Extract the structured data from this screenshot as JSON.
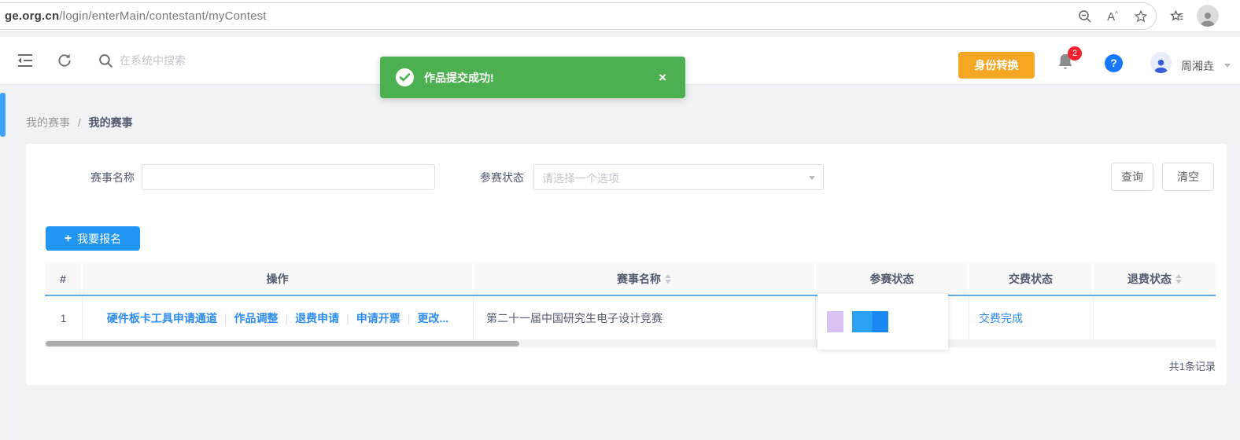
{
  "browser": {
    "url_domain": "ge.org.cn",
    "url_path": "/login/enterMain/contestant/myContest",
    "icons": [
      "zoom-out-icon",
      "read-aloud-icon",
      "favorite-star-icon",
      "collections-icon",
      "profile-avatar"
    ]
  },
  "toolbar": {
    "icons": [
      "menu-fold-icon",
      "refresh-icon",
      "search-icon"
    ],
    "search_placeholder": "在系统中搜索"
  },
  "header": {
    "identity_button": "身份转换",
    "notification_count": "2",
    "help_glyph": "?",
    "username": "周湘垚"
  },
  "toast": {
    "message": "作品提交成功!",
    "close": "×",
    "color": "#4caf50"
  },
  "breadcrumb": {
    "parent": "我的赛事",
    "separator": "/",
    "current": "我的赛事"
  },
  "filter": {
    "name_label": "赛事名称",
    "name_value": "",
    "status_label": "参赛状态",
    "status_placeholder": "请选择一个选项",
    "query_button": "查询",
    "clear_button": "清空"
  },
  "actions": {
    "plus": "+",
    "register_button": "我要报名"
  },
  "table": {
    "columns": [
      {
        "label": "#",
        "sortable": false
      },
      {
        "label": "操作",
        "sortable": false
      },
      {
        "label": "赛事名称",
        "sortable": true
      },
      {
        "label": "参赛状态",
        "sortable": false
      },
      {
        "label": "交费状态",
        "sortable": false
      },
      {
        "label": "退费状态",
        "sortable": true
      }
    ],
    "op_separator": "|",
    "rows": [
      {
        "index": "1",
        "operations": [
          "硬件板卡工具申请通道",
          "作品调整",
          "退费申请",
          "申请开票",
          "更改..."
        ],
        "contest_name": "第二十一届中国研究生电子设计竞赛",
        "participation_status_badges": [
          "redacted-purple",
          "redacted-blue"
        ],
        "payment_status": "交费完成",
        "refund_status": ""
      }
    ],
    "footer_total": "共1条记录"
  },
  "colors": {
    "toast_green": "#4caf50",
    "identity_orange": "#f5a623",
    "register_blue": "#2196f3",
    "link_blue": "#2d8cf0",
    "notification_red": "#f5222d",
    "help_blue": "#1677ff",
    "header_underline_blue": "#5ba9e8",
    "badge_purple": "#d9c2f3",
    "badge_blue": "#1e90f5",
    "scrollbar_thumb_blue": "#3da2f8"
  }
}
